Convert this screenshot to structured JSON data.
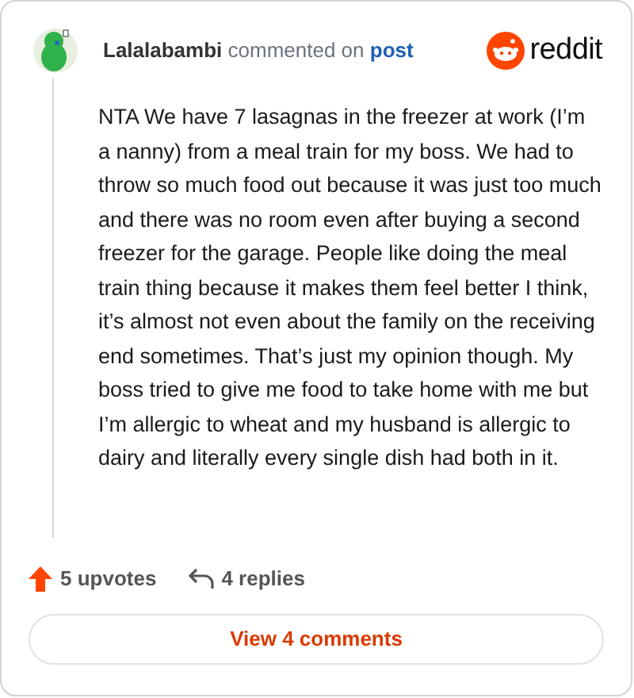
{
  "comment": {
    "author": "Lalalabambi",
    "action": "commented on",
    "link": "post",
    "body": "NTA We have 7 lasagnas in the freezer at work (I’m a nanny) from a meal train for my boss. We had to throw so much food out because it was just too much and there was no room even after buying a second freezer for the garage. People like doing the meal train thing because it makes them feel better I think, it’s almost not even about the family on the receiving end sometimes. That’s just my opinion though. My boss tried to give me food to take home with me but I’m allergic to wheat and my husband is allergic to dairy and literally every single dish had both in it."
  },
  "logo": {
    "text": "reddit"
  },
  "footer": {
    "upvotes": "5 upvotes",
    "replies": "4 replies"
  },
  "button": {
    "label": "View 4 comments"
  }
}
